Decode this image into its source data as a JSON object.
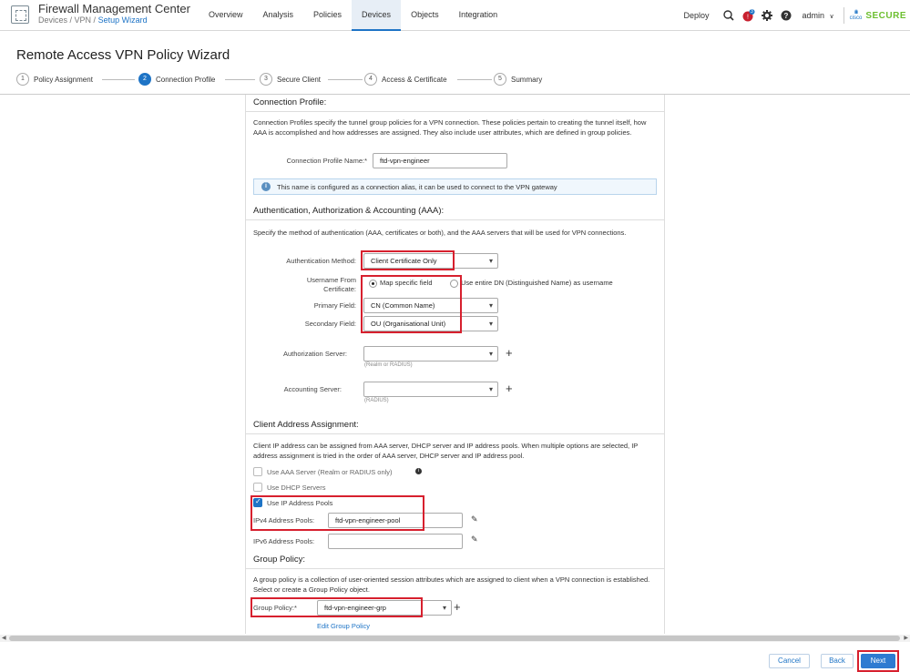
{
  "app": {
    "title": "Firewall Management Center",
    "breadcrumb": {
      "part1": "Devices",
      "sep1": " / ",
      "part2": "VPN",
      "sep2": " / ",
      "part3": "Setup Wizard"
    }
  },
  "nav": {
    "items": [
      "Overview",
      "Analysis",
      "Policies",
      "Devices",
      "Objects",
      "Integration"
    ],
    "active": "Devices",
    "deploy": "Deploy",
    "user": "admin",
    "user_caret": "∨",
    "cisco_word": "cisco",
    "secure_label": "SECURE"
  },
  "wizard": {
    "title": "Remote Access VPN Policy Wizard",
    "steps": [
      {
        "num": "1",
        "label": "Policy Assignment"
      },
      {
        "num": "2",
        "label": "Connection Profile"
      },
      {
        "num": "3",
        "label": "Secure Client"
      },
      {
        "num": "4",
        "label": "Access & Certificate"
      },
      {
        "num": "5",
        "label": "Summary"
      }
    ],
    "current_step": 2
  },
  "connection_profile": {
    "title": "Connection Profile:",
    "description": "Connection Profiles specify the tunnel group policies for a VPN connection. These policies pertain to creating the tunnel itself, how AAA is accomplished and how addresses are assigned. They also include user attributes, which are defined in group policies.",
    "name_label": "Connection Profile Name:*",
    "name_value": "ftd-vpn-engineer",
    "info_text": "This name is configured as a connection alias, it can be used to connect to the VPN gateway"
  },
  "aaa": {
    "title": "Authentication, Authorization & Accounting (AAA):",
    "description": "Specify the method of authentication (AAA, certificates or both), and the AAA servers that will be used for VPN connections.",
    "auth_method_label": "Authentication Method:",
    "auth_method_value": "Client Certificate Only",
    "username_from_label_1": "Username From",
    "username_from_label_2": "Certificate:",
    "radio_map": "Map specific field",
    "radio_dn": "Use entire DN (Distinguished Name) as username",
    "primary_label": "Primary Field:",
    "primary_value": "CN (Common Name)",
    "secondary_label": "Secondary Field:",
    "secondary_value": "OU (Organisational Unit)",
    "authz_label": "Authorization Server:",
    "authz_value": "",
    "authz_hint": "(Realm or RADIUS)",
    "acct_label": "Accounting Server:",
    "acct_value": "",
    "acct_hint": "(RADIUS)"
  },
  "client_address": {
    "title": "Client Address Assignment:",
    "description": "Client IP address can be assigned from AAA server, DHCP server and IP address pools. When multiple options are selected, IP address assignment is tried in the order of AAA server, DHCP server and IP address pool.",
    "use_aaa": "Use AAA Server (Realm or RADIUS only)",
    "use_dhcp": "Use DHCP Servers",
    "use_ip_pools": "Use IP Address Pools",
    "ipv4_label": "IPv4 Address Pools:",
    "ipv4_value": "ftd-vpn-engineer-pool",
    "ipv6_label": "IPv6 Address Pools:",
    "ipv6_value": ""
  },
  "group_policy": {
    "title": "Group Policy:",
    "description": "A group policy is a collection of user-oriented session attributes which are assigned to client when a VPN connection is established. Select or create a Group Policy object.",
    "label": "Group Policy:*",
    "value": "ftd-vpn-engineer-grp",
    "edit_link": "Edit Group Policy"
  },
  "footer": {
    "cancel": "Cancel",
    "back": "Back",
    "next": "Next"
  },
  "icons": {
    "plus": "+",
    "pencil": "✎",
    "info": "i",
    "notification_count": "3"
  },
  "colors": {
    "accent": "#1e74c6",
    "highlight": "#d7202e",
    "secure_green": "#6cbf2f"
  }
}
